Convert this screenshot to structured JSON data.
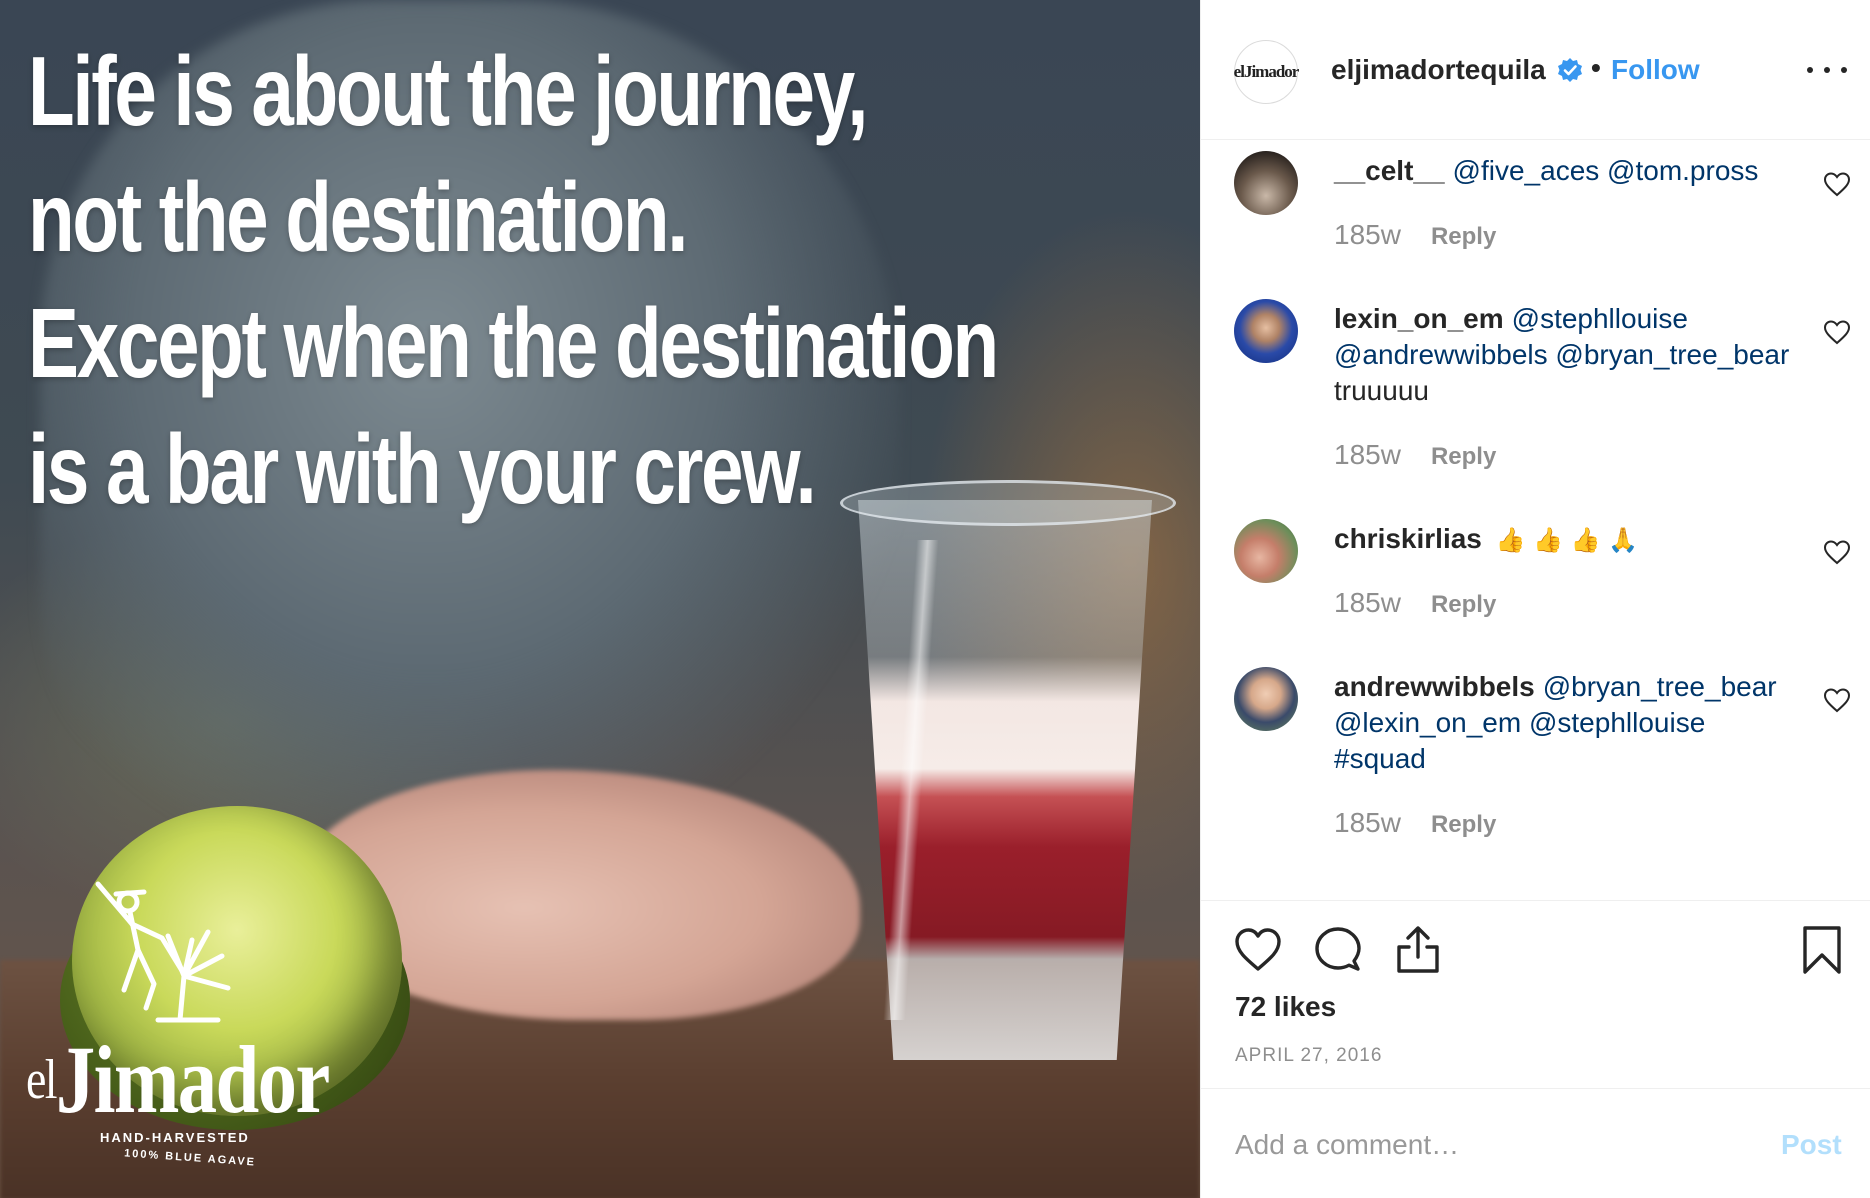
{
  "post": {
    "image": {
      "quote_lines": [
        "Life is about the journey,",
        "not the destination.",
        "Except when the destination",
        "is a bar with your crew."
      ],
      "logo": {
        "prefix": "el",
        "name": "Jimador",
        "tagline": "HAND-HARVESTED",
        "subtagline": "100% BLUE AGAVE"
      }
    }
  },
  "header": {
    "avatar_text": "elJimador",
    "username": "eljimadortequila",
    "separator": "•",
    "follow_label": "Follow",
    "verified_color": "#3897f0"
  },
  "comments": [
    {
      "username": "__celt__",
      "mentions": "@five_aces @tom.pross",
      "text": "",
      "time": "185w",
      "reply_label": "Reply"
    },
    {
      "username": "lexin_on_em",
      "mentions": "@stephllouise @andrewwibbels @bryan_tree_bear",
      "text": " truuuuu",
      "time": "185w",
      "reply_label": "Reply"
    },
    {
      "username": "chriskirlias",
      "mentions": "",
      "text": "👍 👍 👍 🙏",
      "time": "185w",
      "reply_label": "Reply"
    },
    {
      "username": "andrewwibbels",
      "mentions": "@bryan_tree_bear @lexin_on_em @stephllouise #squad",
      "text": "",
      "time": "185w",
      "reply_label": "Reply"
    }
  ],
  "footer": {
    "likes": "72 likes",
    "date": "APRIL 27, 2016",
    "comment_placeholder": "Add a comment…",
    "post_label": "Post"
  },
  "colors": {
    "link": "#003569",
    "accent": "#3897f0",
    "muted": "#8e8e8e",
    "post_disabled": "#b2dffc"
  },
  "icons": [
    "verified-badge-icon",
    "more-options-icon",
    "heart-icon",
    "comment-icon",
    "share-icon",
    "bookmark-icon"
  ]
}
